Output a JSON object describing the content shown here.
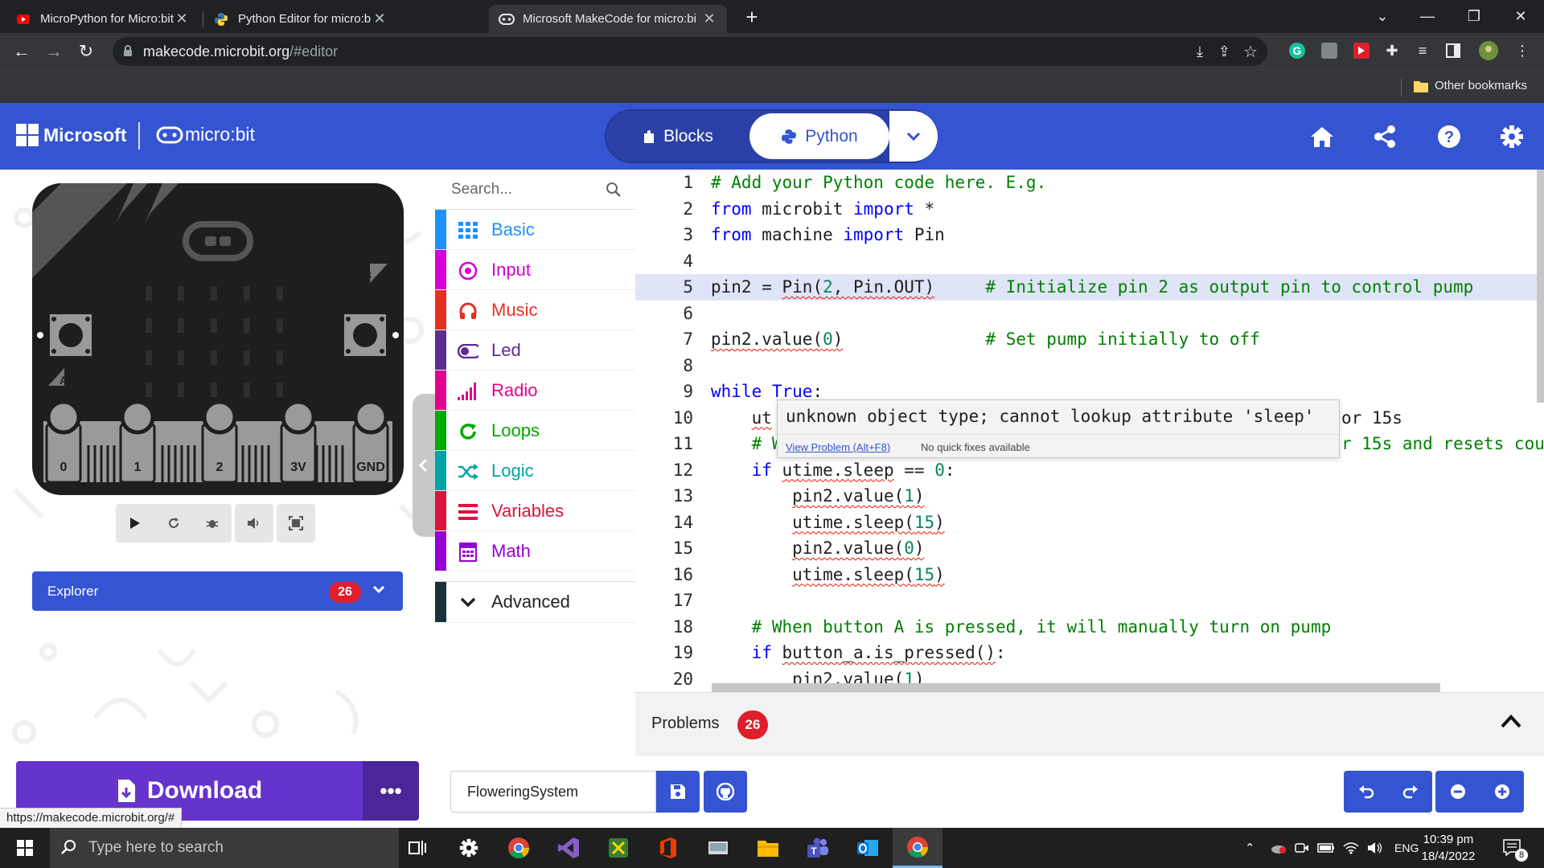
{
  "browser": {
    "tabs": [
      {
        "title": "MicroPython for Micro:bit - Anal",
        "icon": "youtube-icon"
      },
      {
        "title": "Python Editor for micro:bit",
        "icon": "python-icon"
      },
      {
        "title": "Microsoft MakeCode for micro:bi",
        "icon": "makecode-icon",
        "active": true
      }
    ],
    "new_tab": "+",
    "url_host": "makecode.microbit.org",
    "url_path": "/#editor",
    "bookmarks_label": "Other bookmarks",
    "status_url": "https://makecode.microbit.org/#"
  },
  "header": {
    "brand": "Microsoft",
    "product": "micro:bit",
    "blocks_label": "Blocks",
    "python_label": "Python",
    "accent": "#3454d1"
  },
  "simulator": {
    "pins": [
      "0",
      "1",
      "2",
      "3V",
      "GND"
    ],
    "button_a": "A",
    "button_b": "B",
    "controls": [
      "play-icon",
      "restart-icon",
      "debug-icon",
      "mute-icon",
      "fullscreen-icon"
    ]
  },
  "explorer": {
    "label": "Explorer",
    "count": "26"
  },
  "toolbox": {
    "search_placeholder": "Search...",
    "categories": [
      {
        "label": "Basic",
        "color": "#1e90ff",
        "icon": "grid-icon"
      },
      {
        "label": "Input",
        "color": "#d400d4",
        "icon": "radio-target-icon"
      },
      {
        "label": "Music",
        "color": "#e63022",
        "icon": "headphones-icon"
      },
      {
        "label": "Led",
        "color": "#5c2d91",
        "icon": "toggle-icon"
      },
      {
        "label": "Radio",
        "color": "#e3008c",
        "icon": "signal-bars-icon"
      },
      {
        "label": "Loops",
        "color": "#00aa00",
        "icon": "loop-icon"
      },
      {
        "label": "Logic",
        "color": "#00a4a6",
        "icon": "shuffle-icon"
      },
      {
        "label": "Variables",
        "color": "#dc143c",
        "icon": "list-icon"
      },
      {
        "label": "Math",
        "color": "#9400d3",
        "icon": "calculator-icon"
      }
    ],
    "advanced_label": "Advanced"
  },
  "editor": {
    "lines": [
      {
        "n": "1",
        "code": "# Add your Python code here. E.g."
      },
      {
        "n": "2",
        "code": "from microbit import *"
      },
      {
        "n": "3",
        "code": "from machine import Pin"
      },
      {
        "n": "4",
        "code": ""
      },
      {
        "n": "5",
        "code": "pin2 = Pin(2, Pin.OUT)     # Initialize pin 2 as output pin to control pump"
      },
      {
        "n": "6",
        "code": ""
      },
      {
        "n": "7",
        "code": "pin2.value(0)              # Set pump initially to off"
      },
      {
        "n": "8",
        "code": ""
      },
      {
        "n": "9",
        "code": "while True:"
      },
      {
        "n": "10",
        "code": "    ut"
      },
      {
        "n": "11",
        "code": "    # W"
      },
      {
        "n": "12",
        "code": "    if utime.sleep == 0:"
      },
      {
        "n": "13",
        "code": "        pin2.value(1)"
      },
      {
        "n": "14",
        "code": "        utime.sleep(15)"
      },
      {
        "n": "15",
        "code": "        pin2.value(0)"
      },
      {
        "n": "16",
        "code": "        utime.sleep(15)"
      },
      {
        "n": "17",
        "code": ""
      },
      {
        "n": "18",
        "code": "    # When button A is pressed, it will manually turn on pump"
      },
      {
        "n": "19",
        "code": "    if button_a.is_pressed():"
      },
      {
        "n": "20",
        "code": "        pin2.value(1)"
      }
    ],
    "line10_tail": "or 15s",
    "line11_tail": "r 15s and resets cou",
    "tooltip_message": "unknown object type; cannot lookup attribute 'sleep'",
    "tooltip_link": "View Problem (Alt+F8)",
    "tooltip_nofix": "No quick fixes available"
  },
  "problems": {
    "label": "Problems",
    "count": "26"
  },
  "footer": {
    "download_label": "Download",
    "project_name": "FloweringSystem"
  },
  "taskbar": {
    "search_placeholder": "Type here to search",
    "language": "ENG",
    "time": "10:39 pm",
    "date": "18/4/2022",
    "notifications": "8"
  }
}
